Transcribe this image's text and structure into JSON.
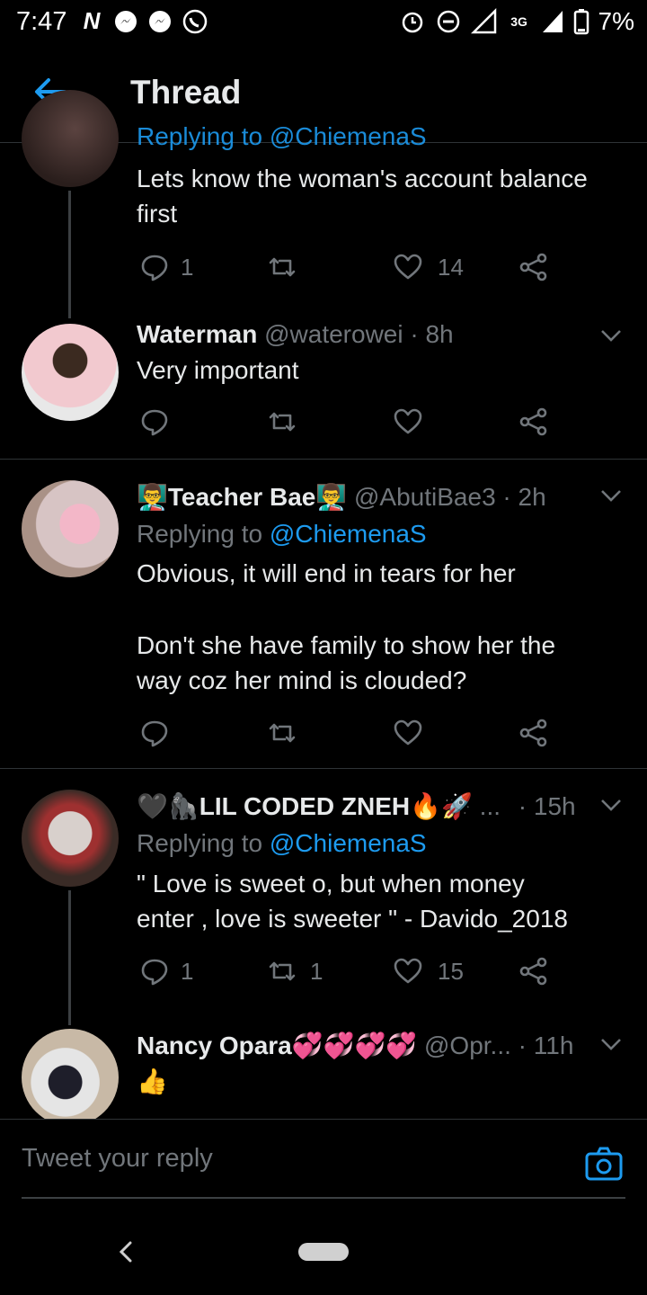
{
  "status_bar": {
    "time": "7:47",
    "left_icons": [
      "N",
      "messenger-icon",
      "messenger-icon",
      "whatsapp-icon"
    ],
    "network": "3G",
    "battery": "7%"
  },
  "header": {
    "title": "Thread"
  },
  "tweets": [
    {
      "replying_partial": "Replying to @ChiemenaS",
      "text_lines": [
        "Lets know the woman's account balance",
        "first"
      ],
      "reply_count": "1",
      "retweet_count": "",
      "like_count": "14"
    },
    {
      "name": "Waterman",
      "handle": "@waterowei",
      "time": "· 8h",
      "text_lines": [
        "Very important"
      ],
      "reply_count": "",
      "retweet_count": "",
      "like_count": ""
    },
    {
      "name": "Teacher Bae",
      "handle": "@AbutiBae3",
      "time": "· 2h",
      "replying_label": "Replying to",
      "replying_to": "@ChiemenaS",
      "text_lines": [
        "Obvious, it will end in tears for her",
        "",
        "Don't she have family to show her the",
        "way coz her mind is clouded?"
      ],
      "reply_count": "",
      "retweet_count": "",
      "like_count": ""
    },
    {
      "name": "LIL CODED ZNEH",
      "name_suffix": "...",
      "handle": "",
      "time": "· 15h",
      "replying_label": "Replying to",
      "replying_to": "@ChiemenaS",
      "text_lines": [
        "\" Love is sweet o, but when money",
        "enter , love is sweeter \" - Davido_2018"
      ],
      "reply_count": "1",
      "retweet_count": "1",
      "like_count": "15"
    },
    {
      "name": "Nancy Opara",
      "handle": "@Opr...",
      "time": "· 11h",
      "text_lines": [
        "👍"
      ]
    }
  ],
  "reply_bar": {
    "placeholder": "Tweet your reply"
  },
  "colors": {
    "accent": "#1d9bf0",
    "background": "#000000",
    "secondary_text": "#71767b"
  }
}
